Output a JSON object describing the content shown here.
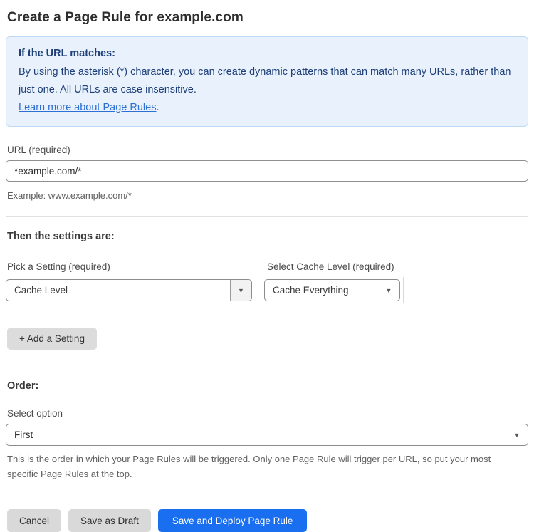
{
  "page": {
    "title": "Create a Page Rule for example.com"
  },
  "info_box": {
    "heading": "If the URL matches:",
    "body": "By using the asterisk (*) character, you can create dynamic patterns that can match many URLs, rather than just one. All URLs are case insensitive.",
    "link_label": "Learn more about Page Rules",
    "link_suffix": "."
  },
  "url_field": {
    "label": "URL (required)",
    "value": "*example.com/*",
    "helper": "Example: www.example.com/*"
  },
  "settings_section": {
    "heading": "Then the settings are:",
    "setting_picker": {
      "label": "Pick a Setting (required)",
      "value": "Cache Level"
    },
    "cache_level_picker": {
      "label": "Select Cache Level (required)",
      "value": "Cache Everything"
    },
    "add_setting_label": "+ Add a Setting"
  },
  "order_section": {
    "heading": "Order:",
    "select_label": "Select option",
    "value": "First",
    "helper": "This is the order in which your Page Rules will be triggered. Only one Page Rule will trigger per URL, so put your most specific Page Rules at the top."
  },
  "footer": {
    "cancel_label": "Cancel",
    "save_draft_label": "Save as Draft",
    "save_deploy_label": "Save and Deploy Page Rule"
  },
  "icons": {
    "dropdown_arrow": "▼"
  },
  "colors": {
    "info_bg": "#e8f1fc",
    "info_border": "#bed9f3",
    "info_text": "#1e3f78",
    "link": "#2e6fd4",
    "primary_button": "#1a6ff0",
    "gray_button": "#d9d9d9"
  }
}
